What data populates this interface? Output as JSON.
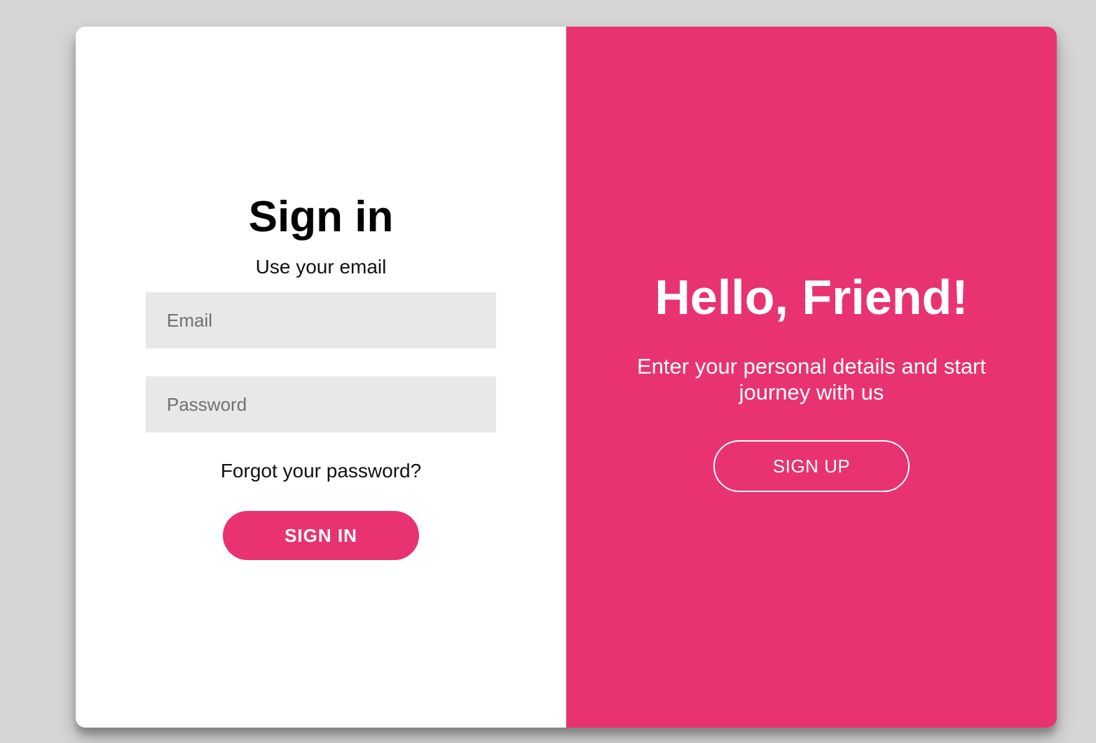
{
  "signin": {
    "title": "Sign in",
    "subtitle": "Use your email",
    "email_placeholder": "Email",
    "password_placeholder": "Password",
    "forgot_label": "Forgot your password?",
    "button_label": "SIGN IN"
  },
  "overlay": {
    "title": "Hello, Friend!",
    "subtitle": "Enter your personal details and start journey with us",
    "button_label": "SIGN UP"
  },
  "colors": {
    "accent": "#e83370",
    "background": "#d6d6d6",
    "input_bg": "#e8e8e8"
  }
}
